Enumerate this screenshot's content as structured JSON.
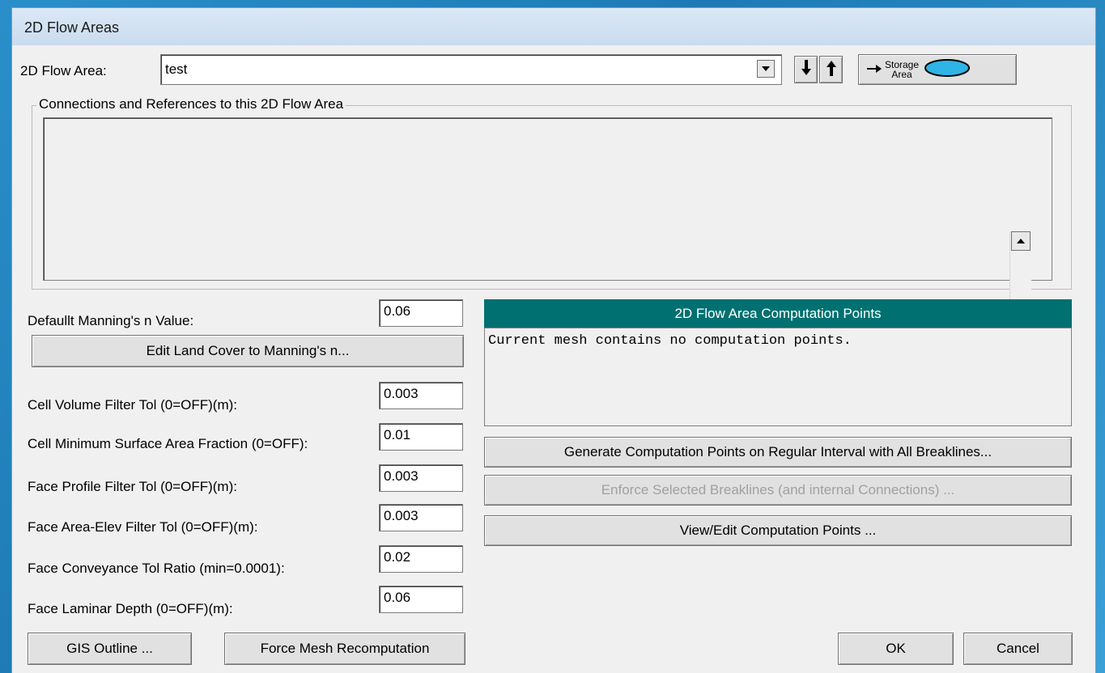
{
  "window": {
    "title": "2D Flow Areas"
  },
  "flow_area": {
    "label": "2D Flow Area:",
    "value": "test",
    "dropdown_icon": "chevron-down-icon",
    "down_icon": "arrow-down-icon",
    "up_icon": "arrow-up-icon",
    "storage_area_line1": "Storage",
    "storage_area_line2": "Area",
    "storage_color": "#2fb4e6"
  },
  "connections": {
    "title": "Connections and References to this 2D Flow Area",
    "items": []
  },
  "params": {
    "mannings_label": "Defaullt Manning's n Value:",
    "mannings_value": "0.06",
    "edit_land_cover_button": "Edit Land Cover to Manning's n...",
    "cell_volume_label": "Cell Volume Filter Tol (0=OFF)(m):",
    "cell_volume_value": "0.003",
    "cell_min_surface_label": "Cell Minimum Surface Area Fraction (0=OFF):",
    "cell_min_surface_value": "0.01",
    "face_profile_label": "Face Profile Filter Tol (0=OFF)(m):",
    "face_profile_value": "0.003",
    "face_area_elev_label": "Face Area-Elev Filter Tol (0=OFF)(m):",
    "face_area_elev_value": "0.003",
    "face_conveyance_label": "Face Conveyance Tol Ratio (min=0.0001):",
    "face_conveyance_value": "0.02",
    "face_laminar_label": "Face Laminar Depth (0=OFF)(m):",
    "face_laminar_value": "0.06"
  },
  "computation_points": {
    "header": "2D Flow Area Computation Points",
    "header_color": "#007070",
    "message": "Current mesh contains no computation points.",
    "generate_button": "Generate Computation Points on Regular Interval with All Breaklines...",
    "enforce_button": "Enforce Selected Breaklines (and internal Connections) ...",
    "view_edit_button": "View/Edit Computation Points ..."
  },
  "footer": {
    "gis_outline_button": "GIS Outline ...",
    "force_mesh_button": "Force Mesh Recomputation",
    "ok_button": "OK",
    "cancel_button": "Cancel"
  }
}
